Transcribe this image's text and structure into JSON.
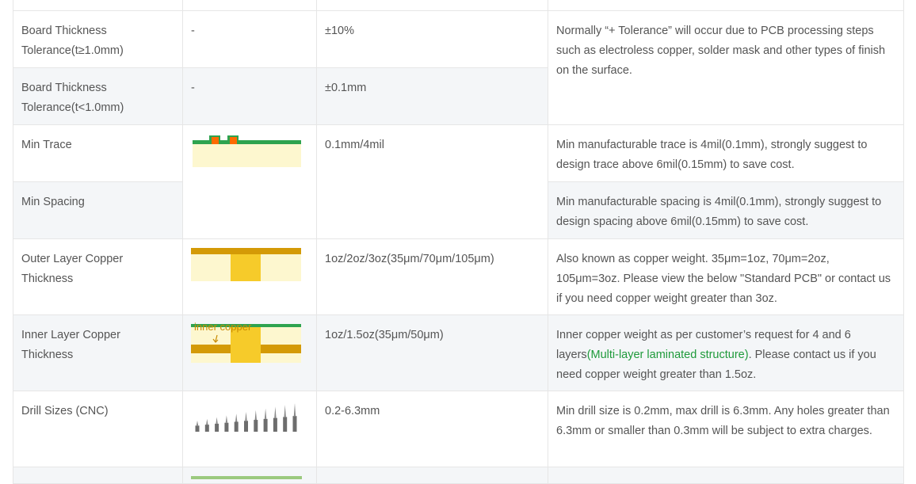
{
  "rows": {
    "board_thickness_ge": {
      "name": "Board Thickness Tolerance(t≥1.0mm)",
      "image": "-",
      "value": "±10%"
    },
    "board_thickness_lt": {
      "name": "Board Thickness Tolerance(t<1.0mm)",
      "image": "-",
      "value": "±0.1mm"
    },
    "board_thickness_note": "Normally “+ Tolerance” will occur due to PCB processing steps such as electroless copper, solder mask and other types of finish on the surface.",
    "min_trace": {
      "name": "Min Trace",
      "value": "0.1mm/4mil",
      "note": "Min manufacturable trace is 4mil(0.1mm), strongly suggest to design trace above 6mil(0.15mm) to save cost."
    },
    "min_spacing": {
      "name": "Min Spacing",
      "note": "Min manufacturable spacing is 4mil(0.1mm), strongly suggest to design spacing above 6mil(0.15mm) to save cost."
    },
    "outer_copper": {
      "name": "Outer Layer Copper Thickness",
      "value": "1oz/2oz/3oz(35μm/70μm/105μm)",
      "note": "Also known as copper weight. 35μm=1oz, 70μm=2oz, 105μm=3oz. Please view the below \"Standard PCB\" or contact us if you need copper weight greater than 3oz."
    },
    "inner_copper": {
      "name": "Inner Layer Copper Thickness",
      "value": "1oz/1.5oz(35μm/50μm)",
      "note_pre": "Inner copper weight as per customer’s request for 4 and 6 layers",
      "note_link": "(Multi-layer laminated structure)",
      "note_post": ". Please contact us if you need copper weight greater than 1.5oz.",
      "diagram_label": "inner copper"
    },
    "drill_sizes": {
      "name": "Drill Sizes (CNC)",
      "value": "0.2-6.3mm",
      "note": "Min drill size is 0.2mm, max drill is 6.3mm. Any holes greater than 6.3mm or smaller than 0.3mm will be subject to extra charges."
    }
  },
  "colors": {
    "copper": "#f6cb2a",
    "dark_copper": "#d49a06",
    "substrate": "#fdf7cf",
    "mask": "#2ea34f",
    "pad": "#ff6a00",
    "link": "#1f9a3b",
    "row_alt": "#f4f6f8",
    "border": "#e6e6e6"
  }
}
